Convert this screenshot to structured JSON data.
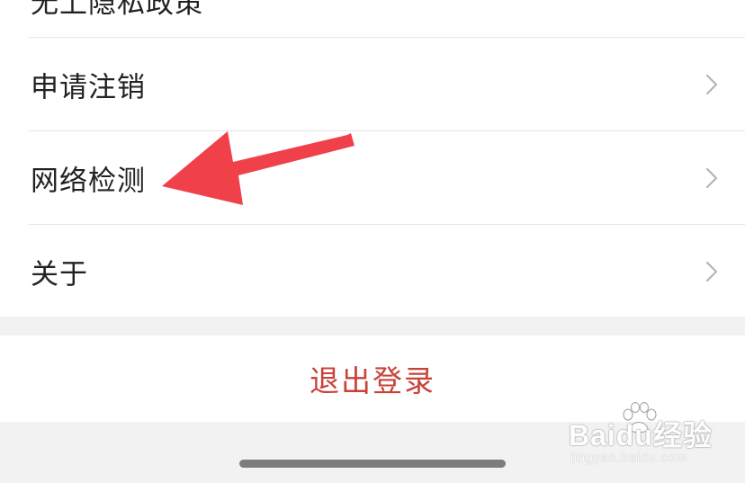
{
  "settings": {
    "partial_item_top": "无上隐私政策",
    "items": [
      {
        "label": "申请注销",
        "icon": "chevron-right-icon"
      },
      {
        "label": "网络检测",
        "icon": "chevron-right-icon"
      },
      {
        "label": "关于",
        "icon": "chevron-right-icon"
      }
    ],
    "logout_label": "退出登录"
  },
  "annotation": {
    "arrow_color": "#f0414b",
    "points_to": "网络检测"
  },
  "watermark": {
    "brand": "Baidu经验",
    "url": "jingyan.baidu.com"
  },
  "colors": {
    "logout_text": "#c8423a",
    "background": "#f2f2f2"
  }
}
